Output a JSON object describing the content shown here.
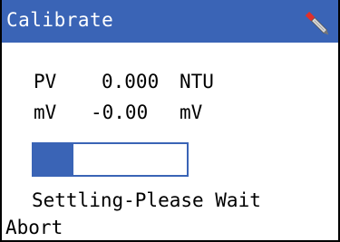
{
  "window": {
    "title": "Calibrate",
    "accent_color": "#3a64b6"
  },
  "header": {
    "icon": "probe-icon"
  },
  "readings": [
    {
      "label": "PV",
      "value": "0.000",
      "unit": "NTU"
    },
    {
      "label": "mV",
      "value": "-0.00",
      "unit": "mV"
    }
  ],
  "progress": {
    "fraction": 0.26
  },
  "status": {
    "text": "Settling-Please Wait"
  },
  "actions": {
    "abort_label": "Abort"
  }
}
